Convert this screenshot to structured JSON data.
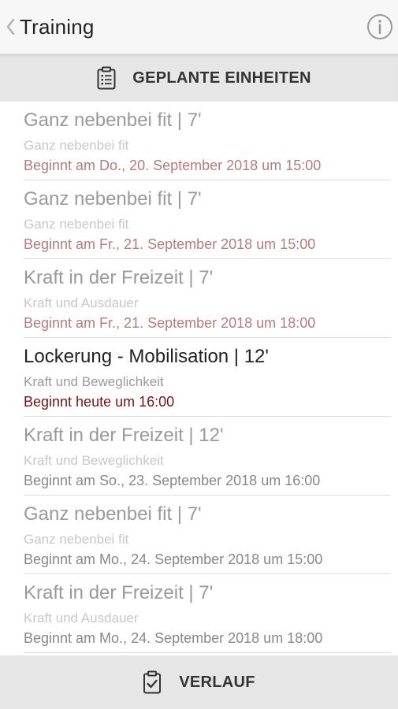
{
  "header": {
    "title": "Training",
    "back_icon": "chevron-left-icon",
    "info_icon": "info-icon"
  },
  "section": {
    "icon": "clipboard-list-icon",
    "label": "GEPLANTE EINHEITEN"
  },
  "items": [
    {
      "title": "Ganz nebenbei fit | 7'",
      "subtitle": "Ganz nebenbei fit",
      "date": "Beginnt am Do., 20. September 2018 um 15:00",
      "state": "past"
    },
    {
      "title": "Ganz nebenbei fit | 7'",
      "subtitle": "Ganz nebenbei fit",
      "date": "Beginnt am Fr., 21. September 2018 um 15:00",
      "state": "past"
    },
    {
      "title": "Kraft in der Freizeit | 7'",
      "subtitle": "Kraft und Ausdauer",
      "date": "Beginnt am Fr., 21. September 2018 um 18:00",
      "state": "past"
    },
    {
      "title": "Lockerung - Mobilisation | 12'",
      "subtitle": "Kraft und Beweglichkeit",
      "date": "Beginnt heute um 16:00",
      "state": "today"
    },
    {
      "title": "Kraft in der Freizeit | 12'",
      "subtitle": "Kraft und Beweglichkeit",
      "date": "Beginnt am So., 23. September 2018 um 16:00",
      "state": "future"
    },
    {
      "title": "Ganz nebenbei fit | 7'",
      "subtitle": "Ganz nebenbei fit",
      "date": "Beginnt am Mo., 24. September 2018 um 15:00",
      "state": "future"
    },
    {
      "title": "Kraft in der Freizeit | 7'",
      "subtitle": "Kraft und Ausdauer",
      "date": "Beginnt am Mo., 24. September 2018 um 18:00",
      "state": "future"
    }
  ],
  "footer": {
    "icon": "clipboard-check-icon",
    "label": "VERLAUF"
  },
  "colors": {
    "past_date": "#b87b7b",
    "today_date": "#7a1212",
    "future_date": "#888888",
    "header_bg": "#e6e6e6"
  }
}
